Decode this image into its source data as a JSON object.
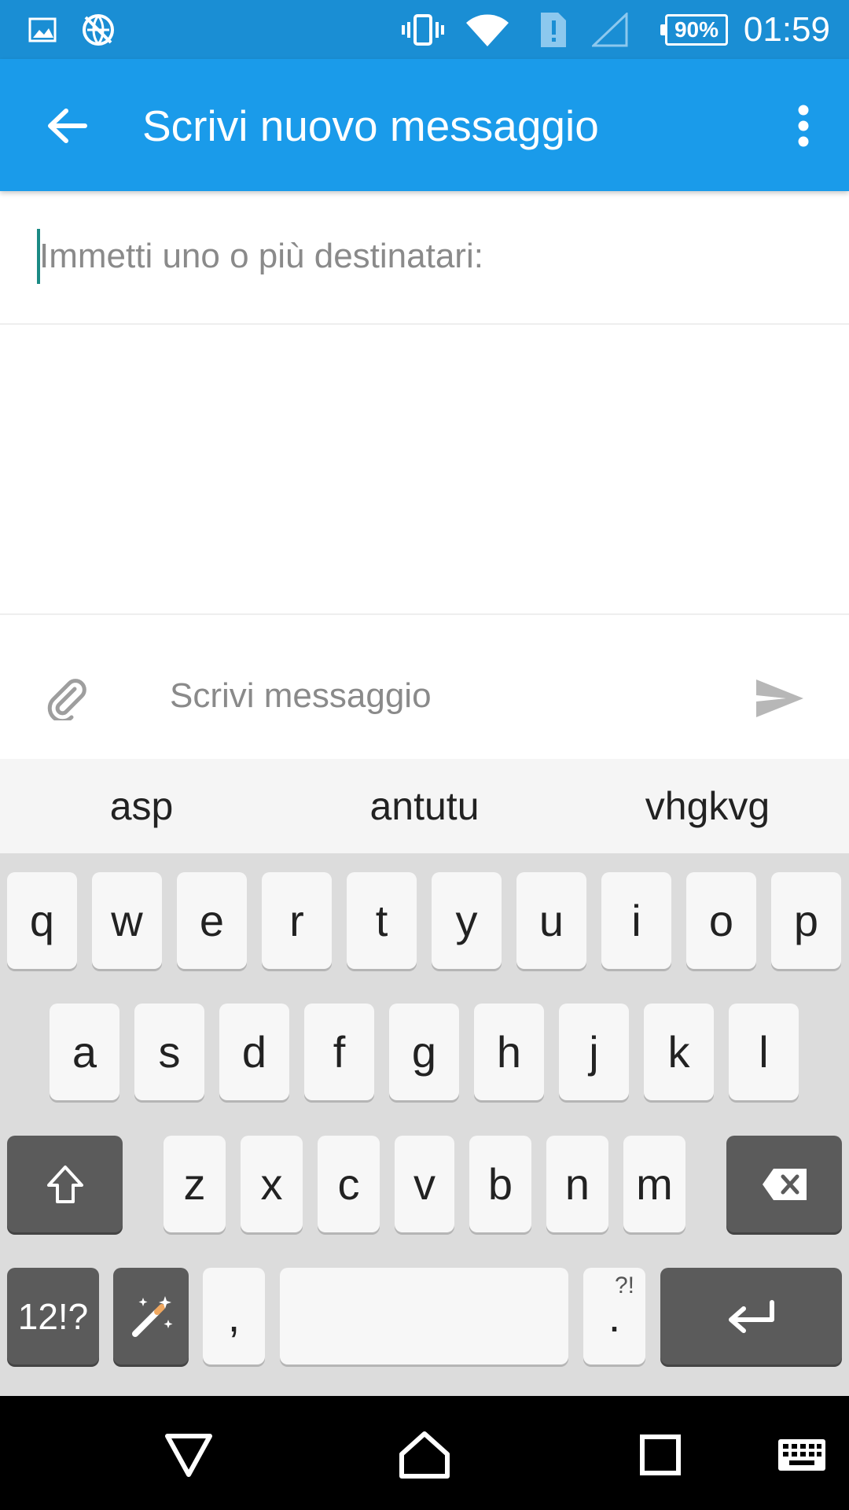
{
  "status_bar": {
    "time": "01:59",
    "battery_percent": "90%",
    "icons": [
      "image-icon",
      "no-sync-icon",
      "vibrate-icon",
      "wifi-icon",
      "sim-alert-icon",
      "signal-icon",
      "battery-icon"
    ]
  },
  "app_bar": {
    "title": "Scrivi nuovo messaggio",
    "back_icon": "arrow-left-icon",
    "more_icon": "more-vert-icon"
  },
  "recipient": {
    "placeholder": "Immetti uno o più destinatari:",
    "value": ""
  },
  "composer": {
    "placeholder": "Scrivi messaggio",
    "value": "",
    "attach_icon": "paperclip-icon",
    "send_icon": "send-icon"
  },
  "suggestions": [
    "asp",
    "antutu",
    "vhgkvg"
  ],
  "keyboard": {
    "row1": [
      "q",
      "w",
      "e",
      "r",
      "t",
      "y",
      "u",
      "i",
      "o",
      "p"
    ],
    "row2": [
      "a",
      "s",
      "d",
      "f",
      "g",
      "h",
      "j",
      "k",
      "l"
    ],
    "row3": [
      "z",
      "x",
      "c",
      "v",
      "b",
      "n",
      "m"
    ],
    "symbols_label": "12!?",
    "comma_label": ",",
    "period_label": ".",
    "period_alt_label": "?!",
    "shift_icon": "shift-icon",
    "backspace_icon": "backspace-icon",
    "magic_icon": "magic-wand-icon",
    "enter_icon": "enter-icon"
  },
  "nav_bar": {
    "icons": [
      "back-triangle-icon",
      "home-icon",
      "recents-icon",
      "keyboard-icon"
    ]
  },
  "colors": {
    "status_bar": "#1a8ed4",
    "app_bar": "#1a9bea",
    "cursor": "#1b8a84",
    "keyboard_bg": "#dcdcdc",
    "key_light": "#f7f7f7",
    "key_dark": "#5b5b5b"
  }
}
